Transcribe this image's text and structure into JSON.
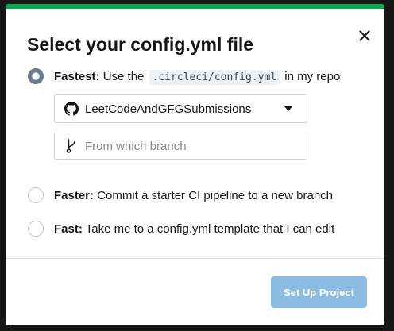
{
  "dialog": {
    "title": "Select your config.yml file",
    "accent_color": "#04aa51"
  },
  "options": [
    {
      "label_strong": "Fastest:",
      "label_pre": "Use the",
      "label_code": ".circleci/config.yml",
      "label_post": "in my repo",
      "selected": true
    },
    {
      "label_strong": "Faster:",
      "label_rest": "Commit a starter CI pipeline to a new branch",
      "selected": false
    },
    {
      "label_strong": "Fast:",
      "label_rest": "Take me to a config.yml template that I can edit",
      "selected": false
    }
  ],
  "repo_select": {
    "value": "LeetCodeAndGFGSubmissions",
    "icon": "github-icon"
  },
  "branch_input": {
    "placeholder": "From which branch",
    "value": "",
    "icon": "git-branch-icon"
  },
  "footer": {
    "setup_label": "Set Up Project",
    "setup_color": "#8cbce3"
  }
}
